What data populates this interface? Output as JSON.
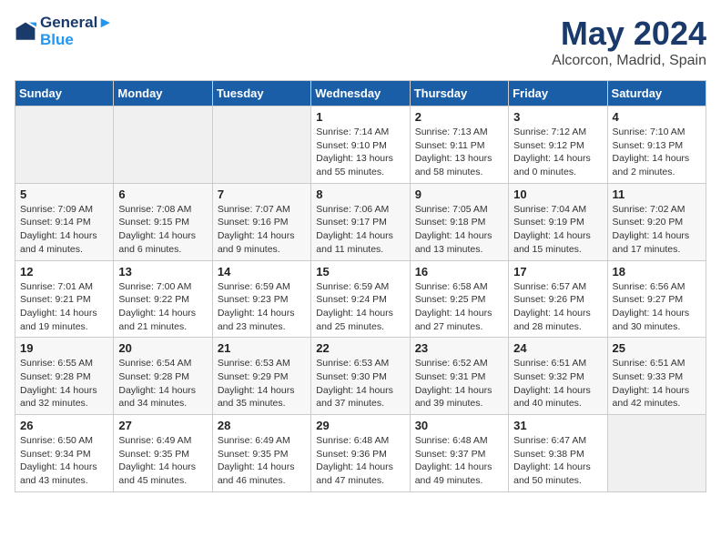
{
  "header": {
    "logo_line1": "General",
    "logo_line2": "Blue",
    "month": "May 2024",
    "location": "Alcorcon, Madrid, Spain"
  },
  "weekdays": [
    "Sunday",
    "Monday",
    "Tuesday",
    "Wednesday",
    "Thursday",
    "Friday",
    "Saturday"
  ],
  "weeks": [
    [
      {
        "day": "",
        "info": ""
      },
      {
        "day": "",
        "info": ""
      },
      {
        "day": "",
        "info": ""
      },
      {
        "day": "1",
        "info": "Sunrise: 7:14 AM\nSunset: 9:10 PM\nDaylight: 13 hours\nand 55 minutes."
      },
      {
        "day": "2",
        "info": "Sunrise: 7:13 AM\nSunset: 9:11 PM\nDaylight: 13 hours\nand 58 minutes."
      },
      {
        "day": "3",
        "info": "Sunrise: 7:12 AM\nSunset: 9:12 PM\nDaylight: 14 hours\nand 0 minutes."
      },
      {
        "day": "4",
        "info": "Sunrise: 7:10 AM\nSunset: 9:13 PM\nDaylight: 14 hours\nand 2 minutes."
      }
    ],
    [
      {
        "day": "5",
        "info": "Sunrise: 7:09 AM\nSunset: 9:14 PM\nDaylight: 14 hours\nand 4 minutes."
      },
      {
        "day": "6",
        "info": "Sunrise: 7:08 AM\nSunset: 9:15 PM\nDaylight: 14 hours\nand 6 minutes."
      },
      {
        "day": "7",
        "info": "Sunrise: 7:07 AM\nSunset: 9:16 PM\nDaylight: 14 hours\nand 9 minutes."
      },
      {
        "day": "8",
        "info": "Sunrise: 7:06 AM\nSunset: 9:17 PM\nDaylight: 14 hours\nand 11 minutes."
      },
      {
        "day": "9",
        "info": "Sunrise: 7:05 AM\nSunset: 9:18 PM\nDaylight: 14 hours\nand 13 minutes."
      },
      {
        "day": "10",
        "info": "Sunrise: 7:04 AM\nSunset: 9:19 PM\nDaylight: 14 hours\nand 15 minutes."
      },
      {
        "day": "11",
        "info": "Sunrise: 7:02 AM\nSunset: 9:20 PM\nDaylight: 14 hours\nand 17 minutes."
      }
    ],
    [
      {
        "day": "12",
        "info": "Sunrise: 7:01 AM\nSunset: 9:21 PM\nDaylight: 14 hours\nand 19 minutes."
      },
      {
        "day": "13",
        "info": "Sunrise: 7:00 AM\nSunset: 9:22 PM\nDaylight: 14 hours\nand 21 minutes."
      },
      {
        "day": "14",
        "info": "Sunrise: 6:59 AM\nSunset: 9:23 PM\nDaylight: 14 hours\nand 23 minutes."
      },
      {
        "day": "15",
        "info": "Sunrise: 6:59 AM\nSunset: 9:24 PM\nDaylight: 14 hours\nand 25 minutes."
      },
      {
        "day": "16",
        "info": "Sunrise: 6:58 AM\nSunset: 9:25 PM\nDaylight: 14 hours\nand 27 minutes."
      },
      {
        "day": "17",
        "info": "Sunrise: 6:57 AM\nSunset: 9:26 PM\nDaylight: 14 hours\nand 28 minutes."
      },
      {
        "day": "18",
        "info": "Sunrise: 6:56 AM\nSunset: 9:27 PM\nDaylight: 14 hours\nand 30 minutes."
      }
    ],
    [
      {
        "day": "19",
        "info": "Sunrise: 6:55 AM\nSunset: 9:28 PM\nDaylight: 14 hours\nand 32 minutes."
      },
      {
        "day": "20",
        "info": "Sunrise: 6:54 AM\nSunset: 9:28 PM\nDaylight: 14 hours\nand 34 minutes."
      },
      {
        "day": "21",
        "info": "Sunrise: 6:53 AM\nSunset: 9:29 PM\nDaylight: 14 hours\nand 35 minutes."
      },
      {
        "day": "22",
        "info": "Sunrise: 6:53 AM\nSunset: 9:30 PM\nDaylight: 14 hours\nand 37 minutes."
      },
      {
        "day": "23",
        "info": "Sunrise: 6:52 AM\nSunset: 9:31 PM\nDaylight: 14 hours\nand 39 minutes."
      },
      {
        "day": "24",
        "info": "Sunrise: 6:51 AM\nSunset: 9:32 PM\nDaylight: 14 hours\nand 40 minutes."
      },
      {
        "day": "25",
        "info": "Sunrise: 6:51 AM\nSunset: 9:33 PM\nDaylight: 14 hours\nand 42 minutes."
      }
    ],
    [
      {
        "day": "26",
        "info": "Sunrise: 6:50 AM\nSunset: 9:34 PM\nDaylight: 14 hours\nand 43 minutes."
      },
      {
        "day": "27",
        "info": "Sunrise: 6:49 AM\nSunset: 9:35 PM\nDaylight: 14 hours\nand 45 minutes."
      },
      {
        "day": "28",
        "info": "Sunrise: 6:49 AM\nSunset: 9:35 PM\nDaylight: 14 hours\nand 46 minutes."
      },
      {
        "day": "29",
        "info": "Sunrise: 6:48 AM\nSunset: 9:36 PM\nDaylight: 14 hours\nand 47 minutes."
      },
      {
        "day": "30",
        "info": "Sunrise: 6:48 AM\nSunset: 9:37 PM\nDaylight: 14 hours\nand 49 minutes."
      },
      {
        "day": "31",
        "info": "Sunrise: 6:47 AM\nSunset: 9:38 PM\nDaylight: 14 hours\nand 50 minutes."
      },
      {
        "day": "",
        "info": ""
      }
    ]
  ]
}
